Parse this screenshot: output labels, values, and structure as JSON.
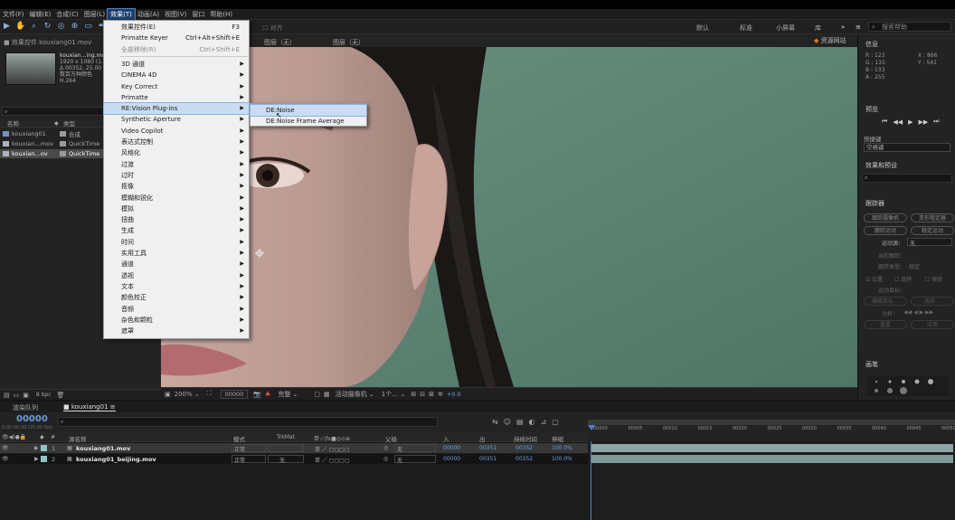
{
  "menubar": {
    "items": [
      "文件(F)",
      "编辑(E)",
      "合成(C)",
      "图层(L)",
      "效果(T)",
      "动画(A)",
      "视图(V)",
      "窗口",
      "帮助(H)"
    ],
    "active_index": 4
  },
  "toolbar": {
    "workspaces": [
      "默认",
      "标准",
      "小屏幕",
      "库"
    ],
    "search_placeholder": "搜索帮助",
    "snap_label": "对齐"
  },
  "project": {
    "tab_title": "效果控件 kouxiang01.mov",
    "file_name": "kouxian…ing.mov",
    "file_info": [
      "1920 x 1080 (1.00)",
      "Δ 00352, 25.00 fps",
      "数百万种颜色",
      "H.264"
    ],
    "columns": [
      "名称",
      "类型"
    ],
    "rows": [
      {
        "name": "kouxiang01",
        "type": "合成"
      },
      {
        "name": "kouxian…mov",
        "type": "QuickTime"
      },
      {
        "name": "kouxian…ov",
        "type": "QuickTime"
      }
    ],
    "bpc": "8 bpc"
  },
  "viewer": {
    "tabs": [
      "图层（无）",
      "图层（无）"
    ],
    "watermark": "资源网站",
    "zoom": "200%",
    "timecode": "00000",
    "quality": "完整",
    "camera": "活动摄像机",
    "views": "1个…",
    "exposure": "+0.0"
  },
  "effects_menu": {
    "items": [
      {
        "label": "效果控件(E)",
        "shortcut": "F3",
        "submenu": false,
        "disabled": false
      },
      {
        "label": "Primatte Keyer",
        "shortcut": "Ctrl+Alt+Shift+E",
        "submenu": false,
        "disabled": false
      },
      {
        "label": "全部移除(R)",
        "shortcut": "Ctrl+Shift+E",
        "submenu": false,
        "disabled": true
      },
      {
        "label": "3D 通道",
        "shortcut": "",
        "submenu": true,
        "disabled": false
      },
      {
        "label": "CINEMA 4D",
        "shortcut": "",
        "submenu": true,
        "disabled": false
      },
      {
        "label": "Key Correct",
        "shortcut": "",
        "submenu": true,
        "disabled": false
      },
      {
        "label": "Primatte",
        "shortcut": "",
        "submenu": true,
        "disabled": false
      },
      {
        "label": "RE:Vision Plug-ins",
        "shortcut": "",
        "submenu": true,
        "disabled": false
      },
      {
        "label": "Synthetic Aperture",
        "shortcut": "",
        "submenu": true,
        "disabled": false
      },
      {
        "label": "Video Copilot",
        "shortcut": "",
        "submenu": true,
        "disabled": false
      },
      {
        "label": "表达式控制",
        "shortcut": "",
        "submenu": true,
        "disabled": false
      },
      {
        "label": "风格化",
        "shortcut": "",
        "submenu": true,
        "disabled": false
      },
      {
        "label": "过渡",
        "shortcut": "",
        "submenu": true,
        "disabled": false
      },
      {
        "label": "过时",
        "shortcut": "",
        "submenu": true,
        "disabled": false
      },
      {
        "label": "抠像",
        "shortcut": "",
        "submenu": true,
        "disabled": false
      },
      {
        "label": "模糊和锐化",
        "shortcut": "",
        "submenu": true,
        "disabled": false
      },
      {
        "label": "模拟",
        "shortcut": "",
        "submenu": true,
        "disabled": false
      },
      {
        "label": "扭曲",
        "shortcut": "",
        "submenu": true,
        "disabled": false
      },
      {
        "label": "生成",
        "shortcut": "",
        "submenu": true,
        "disabled": false
      },
      {
        "label": "时间",
        "shortcut": "",
        "submenu": true,
        "disabled": false
      },
      {
        "label": "实用工具",
        "shortcut": "",
        "submenu": true,
        "disabled": false
      },
      {
        "label": "通道",
        "shortcut": "",
        "submenu": true,
        "disabled": false
      },
      {
        "label": "透视",
        "shortcut": "",
        "submenu": true,
        "disabled": false
      },
      {
        "label": "文本",
        "shortcut": "",
        "submenu": true,
        "disabled": false
      },
      {
        "label": "颜色校正",
        "shortcut": "",
        "submenu": true,
        "disabled": false
      },
      {
        "label": "音频",
        "shortcut": "",
        "submenu": true,
        "disabled": false
      },
      {
        "label": "杂色和颗粒",
        "shortcut": "",
        "submenu": true,
        "disabled": false
      },
      {
        "label": "遮罩",
        "shortcut": "",
        "submenu": true,
        "disabled": false
      }
    ],
    "highlighted_index": 7
  },
  "submenu": {
    "items": [
      "DE:Noise",
      "DE:Noise Frame Average"
    ],
    "highlighted_index": 0
  },
  "info_panel": {
    "title": "信息",
    "r": "R : 123",
    "g": "G : 131",
    "b": "B : 133",
    "a": "A : 255",
    "x": "X : 866",
    "y": "Y : 541"
  },
  "preview_panel": {
    "title": "预览",
    "shortcut_label": "快捷键",
    "shortcut_value": "空格键"
  },
  "effects_presets": {
    "title": "效果和预设"
  },
  "tracker": {
    "title": "跟踪器",
    "buttons": [
      "跟踪摄像机",
      "变形稳定器",
      "跟踪运动",
      "稳定运动"
    ],
    "motion_source_label": "运动源：",
    "motion_source_value": "无",
    "current_track_label": "当前跟踪：",
    "track_type_label": "跟踪类型：",
    "track_type_value": "稳定",
    "position_label": "位置",
    "rotation_label": "旋转",
    "scale_label": "缩放",
    "target_label": "运动目标：",
    "edit_target": "编辑目标…",
    "options": "选项…",
    "analyze_label": "分析：",
    "reset": "重置",
    "apply": "应用"
  },
  "paragraph_panel": {
    "title": "画笔"
  },
  "timeline": {
    "tab": "kouxiang01",
    "render_queue": "渲染队列",
    "timecode": "00000",
    "timecode_sub": "0:00:00:00 (25.00 fps)",
    "columns": {
      "number": "#",
      "source": "源名称",
      "mode": "模式",
      "trkmat": "TrkMat",
      "switches": "单☆\\fx■◎⊙⊕",
      "parent": "父级",
      "in": "入",
      "out": "出",
      "duration": "持续时间",
      "stretch": "伸缩"
    },
    "layers": [
      {
        "num": "1",
        "name": "kouxiang01.mov",
        "mode": "正常",
        "trkmat": "",
        "parent": "无",
        "in": "00000",
        "out": "00351",
        "duration": "00352",
        "stretch": "100.0%"
      },
      {
        "num": "2",
        "name": "kouxiang01_beijing.mov",
        "mode": "正常",
        "trkmat": "无",
        "parent": "无",
        "in": "00000",
        "out": "00351",
        "duration": "00352",
        "stretch": "100.0%"
      }
    ],
    "ruler_ticks": [
      "00000",
      "00005",
      "00010",
      "00015",
      "00020",
      "00025",
      "00030",
      "00035",
      "00040",
      "00045",
      "00050"
    ]
  }
}
